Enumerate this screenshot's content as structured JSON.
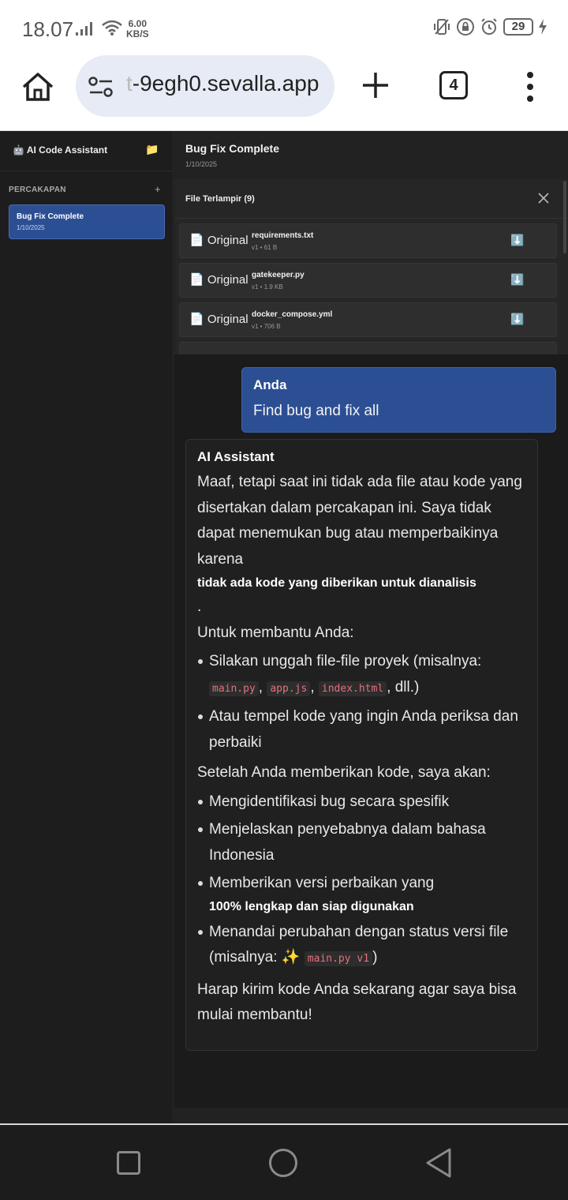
{
  "status_bar": {
    "time": "18.07",
    "net_speed_value": "6.00",
    "net_speed_unit": "KB/S",
    "battery": "29"
  },
  "browser": {
    "url_faded": "t",
    "url_main": "-9egh0.sevalla.app",
    "tab_count": "4"
  },
  "sidebar": {
    "app_title": "🤖 AI Code Assistant",
    "folder_icon": "📁",
    "section_label": "PERCAKAPAN",
    "add_label": "+",
    "conversations": [
      {
        "title": "Bug Fix Complete",
        "date": "1/10/2025"
      }
    ]
  },
  "chat": {
    "title": "Bug Fix Complete",
    "date": "1/10/2025",
    "files_title": "File Terlampir (9)",
    "files": [
      {
        "kind": "📄 Original",
        "name": "requirements.txt",
        "meta": "v1 • 61 B",
        "download_icon": "⬇️"
      },
      {
        "kind": "📄 Original",
        "name": "gatekeeper.py",
        "meta": "v1 • 1.9 KB",
        "download_icon": "⬇️"
      },
      {
        "kind": "📄 Original",
        "name": "docker_compose.yml",
        "meta": "v1 • 706 B",
        "download_icon": "⬇️"
      }
    ],
    "user_message": {
      "sender": "Anda",
      "text": "Find bug and fix all"
    },
    "ai_message": {
      "sender": "AI Assistant",
      "intro": "Maaf, tetapi saat ini tidak ada file atau kode yang disertakan dalam percakapan ini. Saya tidak dapat menemukan bug atau memperbaikinya karena",
      "intro_bold": "tidak ada kode yang diberikan untuk dianalisis",
      "intro_end": ".",
      "help_heading": "Untuk membantu Anda:",
      "help_item1_text": "Silakan unggah file-file proyek (misalnya: ",
      "help_item1_code1": "main.py",
      "help_item1_code2": "app.js",
      "help_item1_code3": "index.html",
      "help_item1_end": ", dll.)",
      "help_item2": "Atau tempel kode yang ingin Anda periksa dan perbaiki",
      "after_heading": "Setelah Anda memberikan kode, saya akan:",
      "after_item1": "Mengidentifikasi bug secara spesifik",
      "after_item2": "Menjelaskan penyebabnya dalam bahasa Indonesia",
      "after_item3_text": "Memberikan versi perbaikan yang",
      "after_item3_bold": "100% lengkap dan siap digunakan",
      "after_item4_text": "Menandai perubahan dengan status versi file (misalnya: ✨ ",
      "after_item4_code": "main.py v1",
      "after_item4_end": ")",
      "closing": "Harap kirim kode Anda sekarang agar saya bisa mulai membantu!"
    }
  }
}
